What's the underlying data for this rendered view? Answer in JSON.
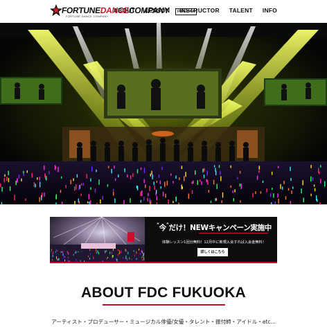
{
  "header": {
    "logo": {
      "part1": "FORTUNE",
      "part2": "DANCE",
      "part3": "COMPANY",
      "badge": "FUKUOKA",
      "tagline": "FORTUNE DANCE COMPANY"
    },
    "nav": [
      "ABOUT",
      "LESSON",
      "INSTRUCTOR",
      "TALENT",
      "INFO"
    ]
  },
  "banner": {
    "quote_open": "“",
    "quote_word": "今",
    "quote_close": "”",
    "title_rest": "だけ！NEWキャンペーン実施中",
    "subtitle": "体験レッスン1回分無料！12月中に新規入会すれば入会金無料！",
    "button": "詳しくはこちら"
  },
  "about": {
    "title": "ABOUT FDC FUKUOKA",
    "text": "アーティスト・プロデューサー・ミュージカル俳優/女優・タレント・振付師・アイドル・etc..."
  },
  "colors": {
    "accent": "#c8102e",
    "text": "#111111",
    "hero_light": "#e8f24a"
  }
}
